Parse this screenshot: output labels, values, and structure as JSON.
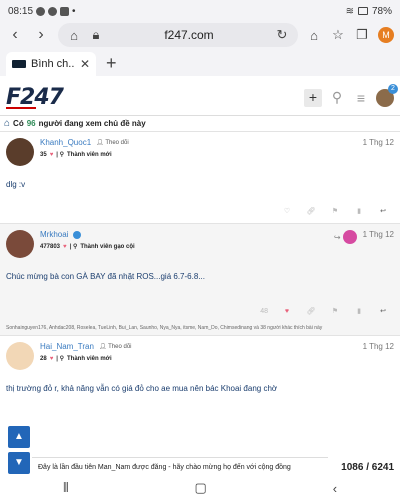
{
  "status": {
    "time": "08:15",
    "battery": "78%"
  },
  "browser": {
    "url": "f247.com",
    "tab_title": "Bình ch...",
    "new_tab_label": "+",
    "profile_initial": "M"
  },
  "site": {
    "logo": "F247",
    "notification_count": "2",
    "online": {
      "prefix": "Có",
      "count": "96",
      "suffix": "người đang xem chủ đề này"
    }
  },
  "posts": [
    {
      "author": "Khanh_Quoc1",
      "follow": "Theo dõi",
      "score": "35",
      "rank": "Thành viên mới",
      "date": "1 Thg 12",
      "body": "dlg :v",
      "avatar_color": "#5a3d2b"
    },
    {
      "author": "Mrkhoai",
      "follow": "",
      "score": "477803",
      "rank": "Thành viên gạo cội",
      "date": "1 Thg 12",
      "body": "Chúc mừng bà con GÀ BAY đã nhặt ROS...giá 6.7-6.8...",
      "like_count": "48",
      "likes_text": "Sonhainguyen176, Anhdac208, Roselea, TueLinh, Bui_Lan, Saunho, Nya_Nya, itsme, Nam_Do, Chimsedinang và 38 người khác thích bài này",
      "avatar_color": "#7a4a3a"
    },
    {
      "author": "Hai_Nam_Tran",
      "follow": "Theo dõi",
      "score": "28",
      "rank": "Thành viên mới",
      "date": "1 Thg 12",
      "body": "thị trường đỏ r, khả năng vẫn có giá đỏ cho ae mua nên bác Khoai đang chờ",
      "avatar_color": "#f2d7b6"
    }
  ],
  "banner": "Đây là lần đầu tiên Man_Nam được đăng - hãy chào mừng họ đến với cộng đồng",
  "progress": "1086 / 6241",
  "icons": [
    "chevron-up-icon",
    "chevron-down-icon",
    "reply-icon",
    "heart-icon",
    "link-icon",
    "flag-icon",
    "bookmark-icon",
    "search-icon",
    "menu-icon"
  ]
}
